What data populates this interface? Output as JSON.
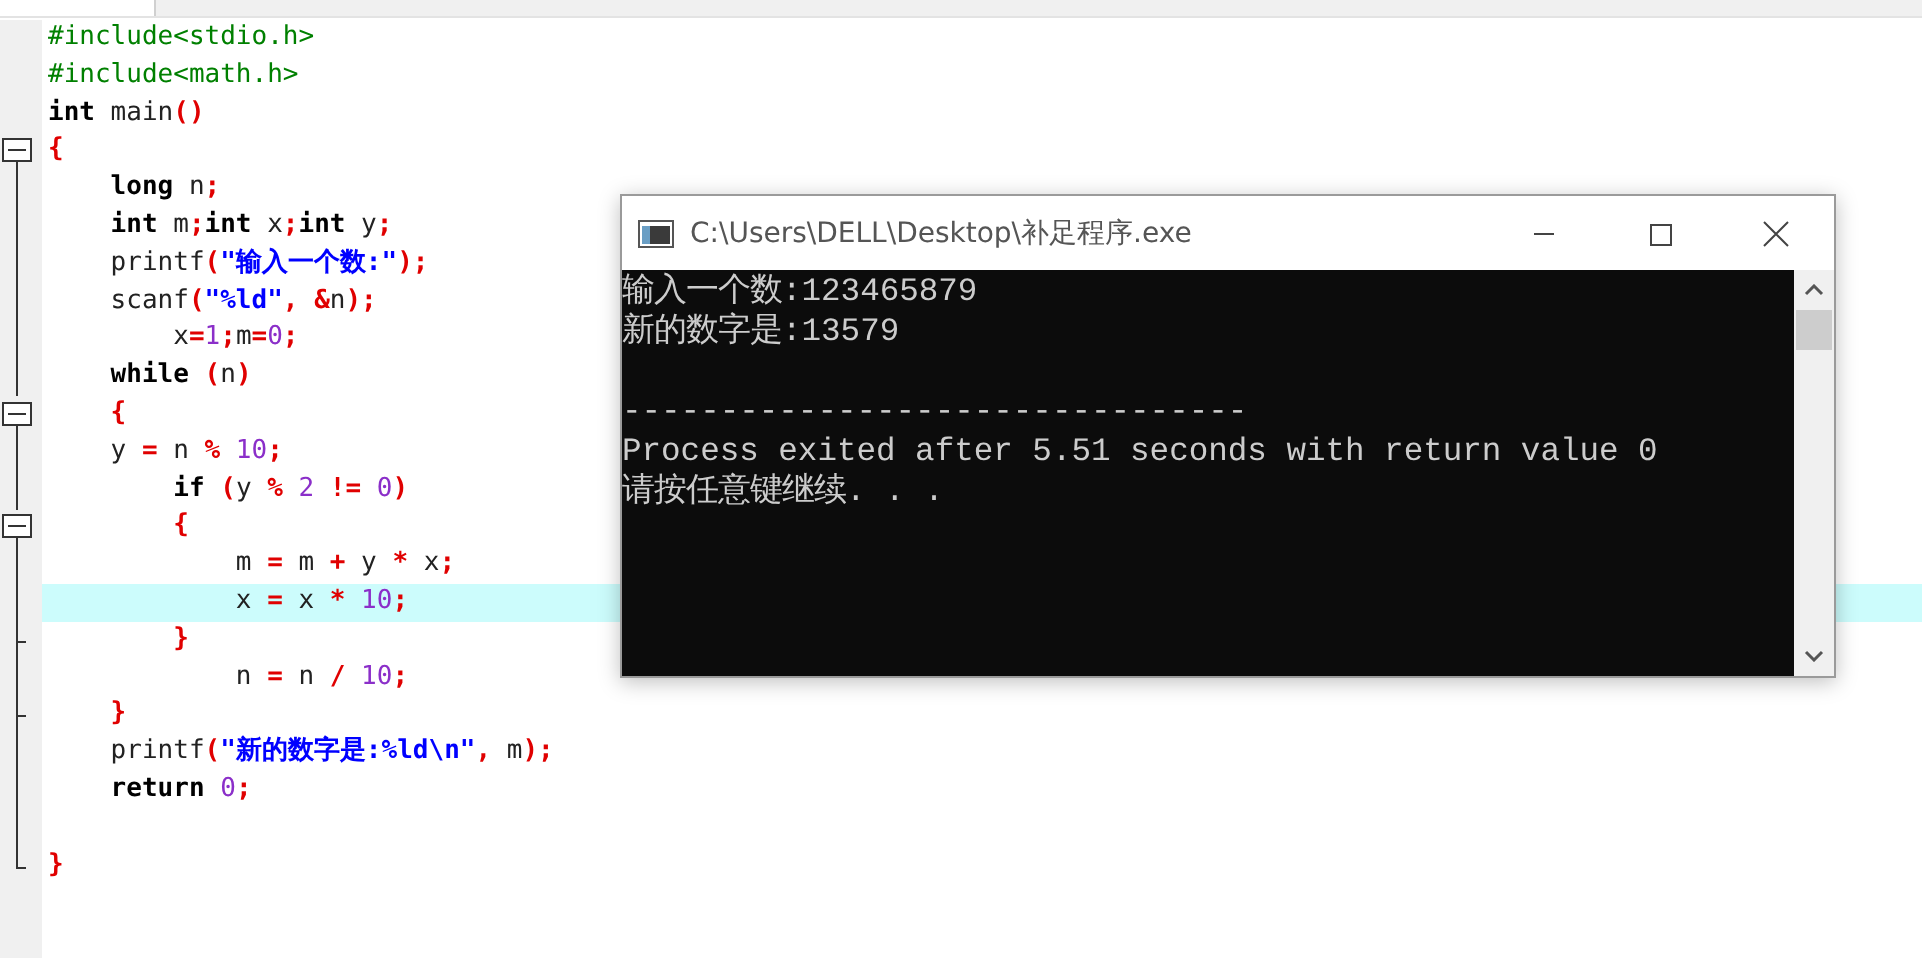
{
  "editor": {
    "lines": [
      {
        "kind": "none",
        "tokens": [
          {
            "kind": "pre",
            "text": "#include<stdio.h>"
          }
        ]
      },
      {
        "kind": "none",
        "tokens": [
          {
            "kind": "pre",
            "text": "#include<math.h>"
          }
        ]
      },
      {
        "kind": "none",
        "tokens": [
          {
            "kind": "kw",
            "text": "int"
          },
          {
            "kind": "id",
            "text": " main"
          },
          {
            "kind": "op",
            "text": "()"
          }
        ]
      },
      {
        "kind": "start",
        "tokens": [
          {
            "kind": "op",
            "text": "{"
          }
        ]
      },
      {
        "kind": "line",
        "tokens": [
          {
            "kind": "kw",
            "text": "    long"
          },
          {
            "kind": "id",
            "text": " n"
          },
          {
            "kind": "op",
            "text": ";"
          }
        ]
      },
      {
        "kind": "line",
        "tokens": [
          {
            "kind": "kw",
            "text": "    int"
          },
          {
            "kind": "id",
            "text": " m"
          },
          {
            "kind": "op",
            "text": ";"
          },
          {
            "kind": "kw",
            "text": "int"
          },
          {
            "kind": "id",
            "text": " x"
          },
          {
            "kind": "op",
            "text": ";"
          },
          {
            "kind": "kw",
            "text": "int"
          },
          {
            "kind": "id",
            "text": " y"
          },
          {
            "kind": "op",
            "text": ";"
          }
        ]
      },
      {
        "kind": "line",
        "tokens": [
          {
            "kind": "id",
            "text": "    printf"
          },
          {
            "kind": "op",
            "text": "("
          },
          {
            "kind": "str",
            "text": "\"输入一个数:\""
          },
          {
            "kind": "op",
            "text": ");"
          }
        ]
      },
      {
        "kind": "line",
        "tokens": [
          {
            "kind": "id",
            "text": "    scanf"
          },
          {
            "kind": "op",
            "text": "("
          },
          {
            "kind": "str",
            "text": "\"%ld\""
          },
          {
            "kind": "op",
            "text": ", &"
          },
          {
            "kind": "id",
            "text": "n"
          },
          {
            "kind": "op",
            "text": ");"
          }
        ]
      },
      {
        "kind": "line",
        "tokens": [
          {
            "kind": "id",
            "text": "        x"
          },
          {
            "kind": "op",
            "text": "="
          },
          {
            "kind": "num",
            "text": "1"
          },
          {
            "kind": "op",
            "text": ";"
          },
          {
            "kind": "id",
            "text": "m"
          },
          {
            "kind": "op",
            "text": "="
          },
          {
            "kind": "num",
            "text": "0"
          },
          {
            "kind": "op",
            "text": ";"
          }
        ]
      },
      {
        "kind": "line",
        "tokens": [
          {
            "kind": "kw",
            "text": "    while"
          },
          {
            "kind": "op",
            "text": " ("
          },
          {
            "kind": "id",
            "text": "n"
          },
          {
            "kind": "op",
            "text": ")"
          }
        ]
      },
      {
        "kind": "start",
        "tokens": [
          {
            "kind": "op",
            "text": "    {"
          }
        ]
      },
      {
        "kind": "line",
        "tokens": [
          {
            "kind": "id",
            "text": "    y "
          },
          {
            "kind": "op",
            "text": "="
          },
          {
            "kind": "id",
            "text": " n "
          },
          {
            "kind": "op",
            "text": "%"
          },
          {
            "kind": "num",
            "text": " 10"
          },
          {
            "kind": "op",
            "text": ";"
          }
        ]
      },
      {
        "kind": "line",
        "tokens": [
          {
            "kind": "kw",
            "text": "        if"
          },
          {
            "kind": "op",
            "text": " ("
          },
          {
            "kind": "id",
            "text": "y "
          },
          {
            "kind": "op",
            "text": "%"
          },
          {
            "kind": "num",
            "text": " 2 "
          },
          {
            "kind": "op",
            "text": "!="
          },
          {
            "kind": "num",
            "text": " 0"
          },
          {
            "kind": "op",
            "text": ")"
          }
        ]
      },
      {
        "kind": "start",
        "tokens": [
          {
            "kind": "op",
            "text": "        {"
          }
        ]
      },
      {
        "kind": "line",
        "tokens": [
          {
            "kind": "id",
            "text": "            m "
          },
          {
            "kind": "op",
            "text": "="
          },
          {
            "kind": "id",
            "text": " m "
          },
          {
            "kind": "op",
            "text": "+"
          },
          {
            "kind": "id",
            "text": " y "
          },
          {
            "kind": "op",
            "text": "*"
          },
          {
            "kind": "id",
            "text": " x"
          },
          {
            "kind": "op",
            "text": ";"
          }
        ]
      },
      {
        "kind": "line",
        "highlighted": true,
        "tokens": [
          {
            "kind": "id",
            "text": "            x "
          },
          {
            "kind": "op",
            "text": "="
          },
          {
            "kind": "id",
            "text": " x "
          },
          {
            "kind": "op",
            "text": "*"
          },
          {
            "kind": "num",
            "text": " 10"
          },
          {
            "kind": "op",
            "text": ";"
          }
        ]
      },
      {
        "kind": "end",
        "tokens": [
          {
            "kind": "op",
            "text": "        }"
          }
        ]
      },
      {
        "kind": "line",
        "tokens": [
          {
            "kind": "id",
            "text": "            n "
          },
          {
            "kind": "op",
            "text": "="
          },
          {
            "kind": "id",
            "text": " n "
          },
          {
            "kind": "op",
            "text": "/"
          },
          {
            "kind": "num",
            "text": " 10"
          },
          {
            "kind": "op",
            "text": ";"
          }
        ]
      },
      {
        "kind": "end",
        "tokens": [
          {
            "kind": "op",
            "text": "    }"
          }
        ]
      },
      {
        "kind": "line",
        "tokens": [
          {
            "kind": "id",
            "text": "    printf"
          },
          {
            "kind": "op",
            "text": "("
          },
          {
            "kind": "str",
            "text": "\"新的数字是:%ld\\n\""
          },
          {
            "kind": "op",
            "text": ", "
          },
          {
            "kind": "id",
            "text": "m"
          },
          {
            "kind": "op",
            "text": ");"
          }
        ]
      },
      {
        "kind": "line",
        "tokens": [
          {
            "kind": "kw",
            "text": "    return"
          },
          {
            "kind": "num",
            "text": " 0"
          },
          {
            "kind": "op",
            "text": ";"
          }
        ]
      },
      {
        "kind": "line"
      },
      {
        "kind": "last",
        "tokens": [
          {
            "kind": "op",
            "text": "}"
          }
        ]
      }
    ]
  },
  "console": {
    "title": "C:\\Users\\DELL\\Desktop\\补足程序.exe",
    "lines": [
      {
        "kind": "text",
        "text": "输入一个数:123465879"
      },
      {
        "kind": "text",
        "text": "新的数字是:13579"
      },
      {
        "kind": "rule",
        "text": "--------------------------------"
      },
      {
        "kind": "text",
        "text": "Process exited after 5.51 seconds with return value 0"
      },
      {
        "kind": "text",
        "text": "请按任意键继续. . ."
      }
    ]
  }
}
